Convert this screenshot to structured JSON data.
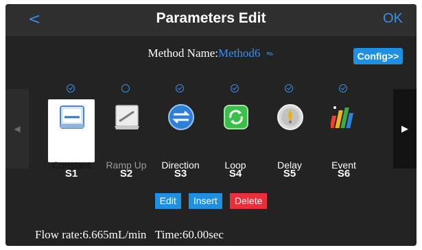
{
  "header": {
    "back_glyph": "<",
    "title": "Parameters Edit",
    "ok_label": "OK"
  },
  "method": {
    "label": "Method Name:",
    "value": "Method6",
    "config_label": "Config>>"
  },
  "steps": [
    {
      "label": "Constant",
      "id": "S1",
      "checked": true,
      "selected": true,
      "icon": "constant-icon"
    },
    {
      "label": "Ramp Up",
      "id": "S2",
      "checked": false,
      "selected": false,
      "icon": "ramp-up-icon"
    },
    {
      "label": "Direction",
      "id": "S3",
      "checked": true,
      "selected": false,
      "icon": "direction-icon"
    },
    {
      "label": "Loop",
      "id": "S4",
      "checked": true,
      "selected": false,
      "icon": "loop-icon"
    },
    {
      "label": "Delay",
      "id": "S5",
      "checked": true,
      "selected": false,
      "icon": "delay-icon"
    },
    {
      "label": "Event",
      "id": "S6",
      "checked": true,
      "selected": false,
      "icon": "event-icon"
    }
  ],
  "actions": {
    "edit": "Edit",
    "insert": "Insert",
    "delete": "Delete"
  },
  "status": {
    "flow_label": "Flow rate:",
    "flow_value": "6.665mL/min",
    "time_label": "Time:",
    "time_value": "60.00sec"
  },
  "colors": {
    "accent": "#3a8fe8",
    "delete": "#e8303a",
    "background": "#232323"
  }
}
